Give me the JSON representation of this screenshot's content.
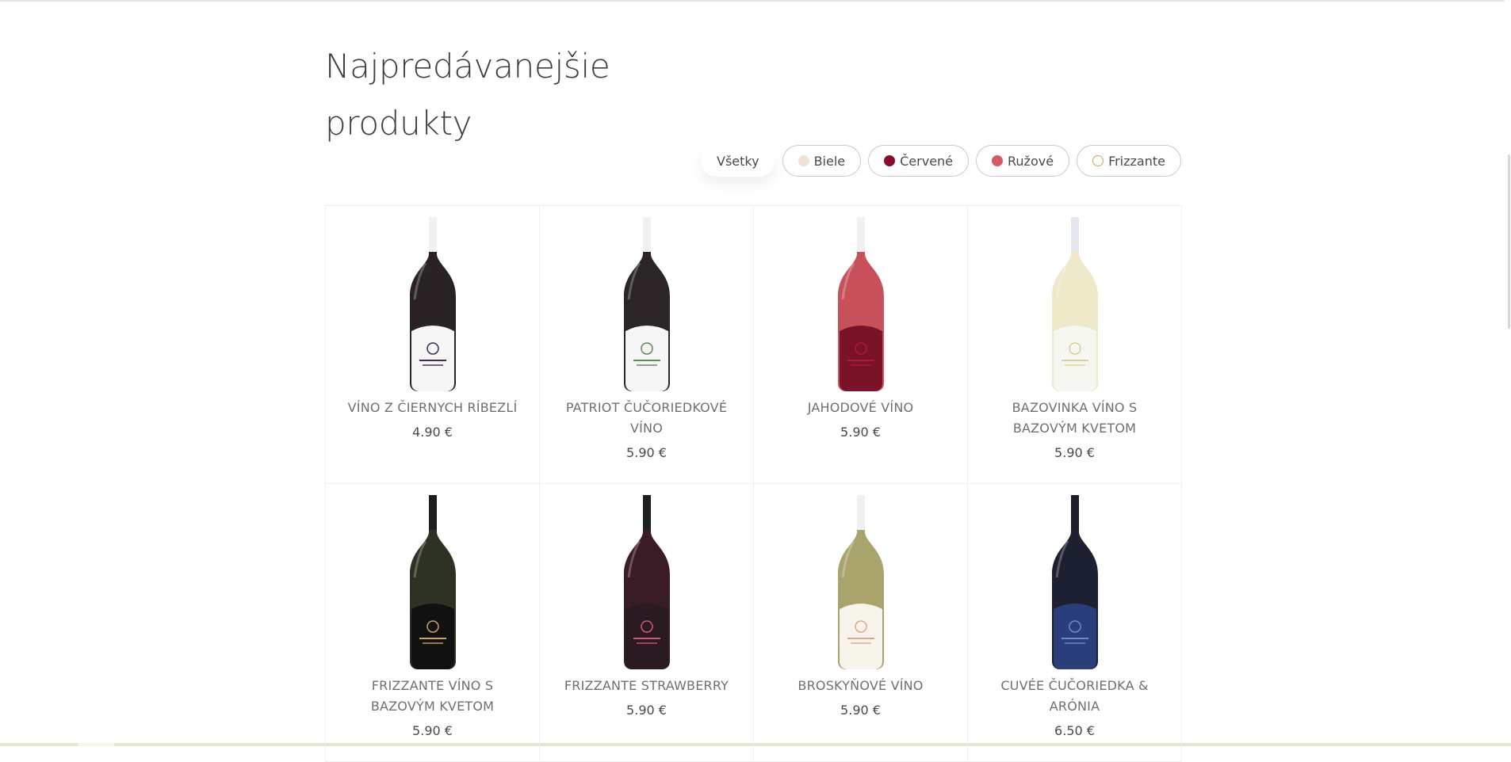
{
  "page": {
    "title_line1": "Najpredávanejšie",
    "title_line2": "produkty"
  },
  "filters": [
    {
      "label": "Všetky",
      "active": true,
      "dot_color": null,
      "dot_style": "none"
    },
    {
      "label": "Biele",
      "active": false,
      "dot_color": "#efe3d6",
      "dot_style": "fill"
    },
    {
      "label": "Červené",
      "active": false,
      "dot_color": "#8c0a2c",
      "dot_style": "fill"
    },
    {
      "label": "Ružové",
      "active": false,
      "dot_color": "#d45a66",
      "dot_style": "fill"
    },
    {
      "label": "Frizzante",
      "active": false,
      "dot_color": "#c9a46a",
      "dot_style": "outline"
    }
  ],
  "products": [
    {
      "name": "VÍNO Z ČIERNYCH RÍBEZLÍ",
      "price": "4.90 €",
      "icon": "blackcurrant-wine-bottle-icon",
      "glass": "#2a2326",
      "neck": "#f1f1f1",
      "label": "#f6f6f6",
      "accent": "#3d2a55"
    },
    {
      "name": "PATRIOT ČUČORIEDKOVÉ VÍNO",
      "price": "5.90 €",
      "icon": "blueberry-wine-bottle-icon",
      "glass": "#2b2528",
      "neck": "#f1f1f1",
      "label": "#f6f6f6",
      "accent": "#5a8a5a"
    },
    {
      "name": "JAHODOVÉ VÍNO",
      "price": "5.90 €",
      "icon": "strawberry-wine-bottle-icon",
      "glass": "#c8505a",
      "neck": "#f1f1f1",
      "label": "#7a1228",
      "accent": "#b01a36"
    },
    {
      "name": "BAZOVINKA VÍNO S BAZOVÝM KVETOM",
      "price": "5.90 €",
      "icon": "elderflower-wine-bottle-icon",
      "glass": "#eee9c9",
      "neck": "#e4e7ee",
      "label": "#f7f7f2",
      "accent": "#d8d0a0"
    },
    {
      "name": "FRIZZANTE VÍNO S BAZOVÝM KVETOM",
      "price": "5.90 €",
      "icon": "frizzante-elderflower-bottle-icon",
      "glass": "#2e3224",
      "neck": "#1e1e1e",
      "label": "#111111",
      "accent": "#caa55a"
    },
    {
      "name": "FRIZZANTE STRAWBERRY",
      "price": "5.90 €",
      "icon": "frizzante-strawberry-bottle-icon",
      "glass": "#3a1c26",
      "neck": "#1e1e1e",
      "label": "#2a1a22",
      "accent": "#d1537d"
    },
    {
      "name": "BROSKYŇOVÉ VÍNO",
      "price": "5.90 €",
      "icon": "peach-wine-bottle-icon",
      "glass": "#a9a36c",
      "neck": "#f1f1f1",
      "label": "#f7f4ec",
      "accent": "#e3a58a"
    },
    {
      "name": "CUVÉE ČUČORIEDKA & ARÓNIA",
      "price": "6.50 €",
      "icon": "blueberry-aronia-bottle-icon",
      "glass": "#1d2030",
      "neck": "#1e1e2a",
      "label": "#2a3f7a",
      "accent": "#6a8ad0"
    }
  ]
}
